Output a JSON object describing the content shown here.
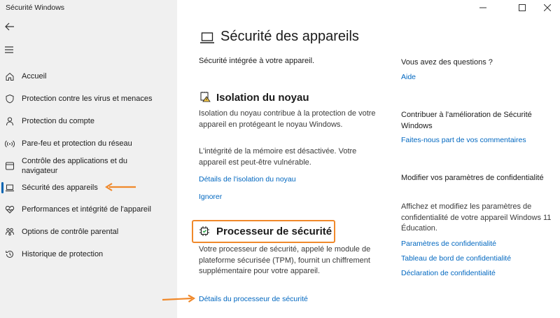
{
  "window": {
    "title": "Sécurité Windows",
    "minimize_glyph": "—",
    "maximize_glyph": "☐",
    "close_glyph": "✕"
  },
  "sidebar": {
    "items": [
      {
        "label": "Accueil",
        "icon": "home-icon"
      },
      {
        "label": "Protection contre les virus et menaces",
        "icon": "shield-icon"
      },
      {
        "label": "Protection du compte",
        "icon": "person-icon"
      },
      {
        "label": "Pare-feu et protection du réseau",
        "icon": "wifi-icon"
      },
      {
        "label": "Contrôle des applications et du navigateur",
        "icon": "app-browser-icon"
      },
      {
        "label": "Sécurité des appareils",
        "icon": "laptop-icon",
        "active": true
      },
      {
        "label": "Performances et intégrité de l'appareil",
        "icon": "heart-icon"
      },
      {
        "label": "Options de contrôle parental",
        "icon": "family-icon"
      },
      {
        "label": "Historique de protection",
        "icon": "history-icon"
      }
    ]
  },
  "main": {
    "title": "Sécurité des appareils",
    "intro": "Sécurité intégrée à votre appareil.",
    "core_isolation": {
      "title": "Isolation du noyau",
      "description": "Isolation du noyau contribue à la protection de votre appareil en protégeant le noyau Windows.",
      "warning": "L'intégrité de la mémoire est désactivée. Votre appareil est peut-être vulnérable.",
      "details_link": "Détails de l'isolation du noyau",
      "ignore_link": "Ignorer"
    },
    "security_processor": {
      "title": "Processeur de sécurité",
      "description": "Votre processeur de sécurité, appelé le module de plateforme sécurisée (TPM), fournit un chiffrement supplémentaire pour votre appareil.",
      "details_link": "Détails du processeur de sécurité"
    }
  },
  "right": {
    "questions_heading": "Vous avez des questions ?",
    "help_link": "Aide",
    "contribute_heading": "Contribuer à l'amélioration de Sécurité Windows",
    "feedback_link": "Faites-nous part de vos commentaires",
    "privacy_heading": "Modifier vos paramètres de confidentialité",
    "privacy_text": "Affichez et modifiez les paramètres de confidentialité de votre appareil Windows 11 Éducation.",
    "privacy_settings_link": "Paramètres de confidentialité",
    "privacy_dashboard_link": "Tableau de bord de confidentialité",
    "privacy_statement_link": "Déclaration de confidentialité"
  },
  "colors": {
    "accent": "#0067c0",
    "highlight": "#f0892b",
    "sidebar_bg": "#f0f0f0"
  }
}
